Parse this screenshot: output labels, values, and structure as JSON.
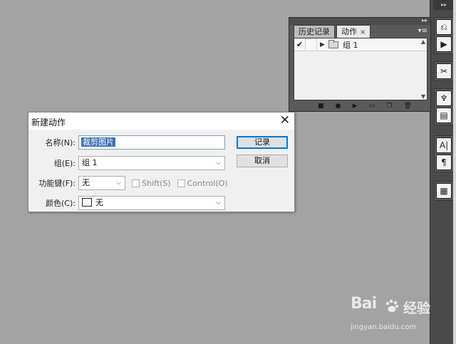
{
  "panel": {
    "tabs": [
      {
        "label": "历史记录"
      },
      {
        "label": "动作"
      }
    ],
    "tab_close": "×",
    "rows": [
      {
        "label": "组 1",
        "checked": "✔"
      }
    ]
  },
  "dialog": {
    "title": "新建动作",
    "close": "✕",
    "name_label": "名称(N):",
    "name_value": "裁剪图片",
    "group_label": "组(E):",
    "group_value": "组 1",
    "fkey_label": "功能键(F):",
    "fkey_value": "无",
    "shift_label": "Shift(S)",
    "control_label": "Control(O)",
    "color_label": "颜色(C):",
    "color_value": "无",
    "record_button": "记录",
    "cancel_button": "取消"
  },
  "watermark": {
    "brand_a": "Bai",
    "brand_b": "经验",
    "url": "jingyan.baidu.com"
  },
  "colors": {
    "background": "#a3a3a3",
    "accent": "#0078d7",
    "selection": "#3b6fb6"
  }
}
